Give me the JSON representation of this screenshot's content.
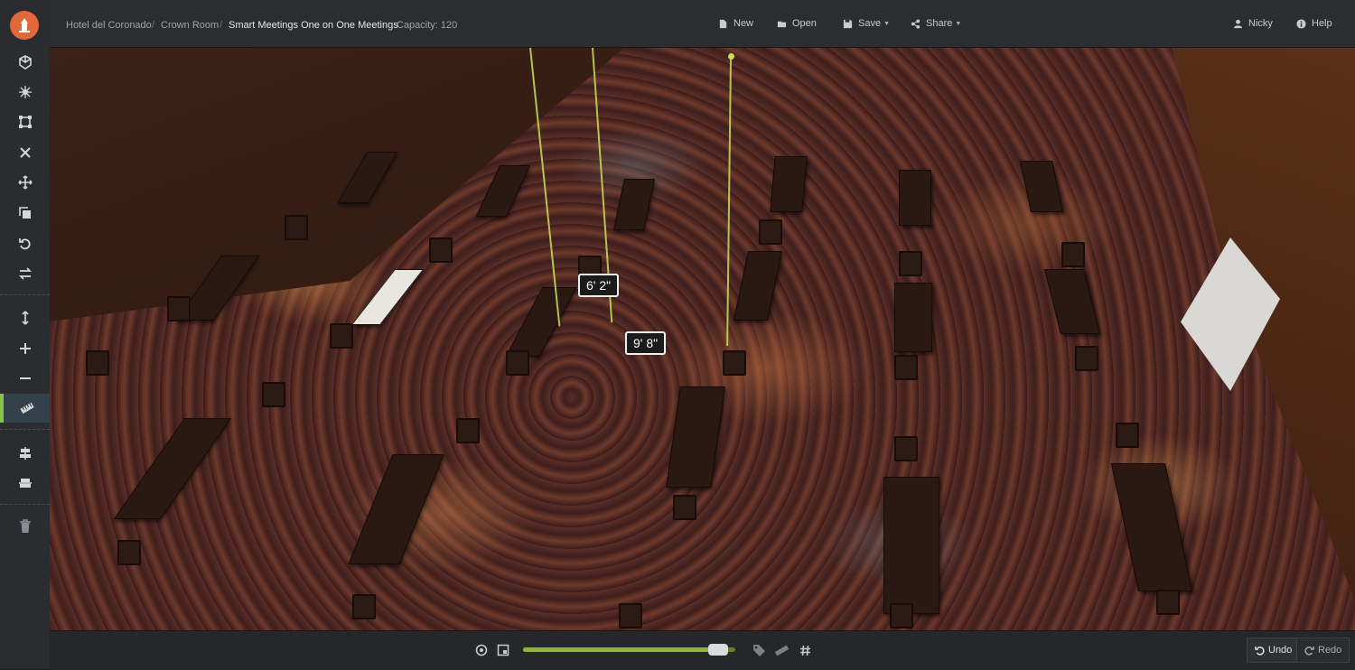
{
  "breadcrumb": {
    "venue": "Hotel del Coronado",
    "room": "Crown Room",
    "layout": "Smart Meetings One on One Meetings",
    "capacity": "Capacity: 120"
  },
  "toolbar": {
    "new_label": "New",
    "open_label": "Open",
    "save_label": "Save",
    "share_label": "Share",
    "user_label": "Nicky",
    "help_label": "Help"
  },
  "sidebar": {
    "tools": [
      {
        "name": "cube-icon",
        "active": false
      },
      {
        "name": "asterisk-icon",
        "active": false
      },
      {
        "name": "vector-square-icon",
        "active": false
      },
      {
        "name": "close-icon",
        "active": false
      },
      {
        "name": "move-icon",
        "active": false
      },
      {
        "name": "duplicate-icon",
        "active": false
      },
      {
        "name": "rotate-icon",
        "active": false
      },
      {
        "name": "swap-icon",
        "active": false
      },
      {
        "name": "vertical-resize-icon",
        "active": false
      },
      {
        "name": "plus-icon",
        "active": false
      },
      {
        "name": "minus-icon",
        "active": false
      },
      {
        "name": "ruler-icon",
        "active": true
      },
      {
        "name": "align-center-icon",
        "active": false
      },
      {
        "name": "align-middle-icon",
        "active": false
      },
      {
        "name": "trash-icon",
        "active": false
      }
    ]
  },
  "viewport": {
    "measurements": [
      "6' 2\"",
      "9' 8\""
    ]
  },
  "bottombar": {
    "zoom_level": 0.92,
    "undo_label": "Undo",
    "redo_label": "Redo"
  },
  "colors": {
    "accent": "#8bc34a",
    "logo": "#e0683a",
    "guide": "#c9df55"
  }
}
